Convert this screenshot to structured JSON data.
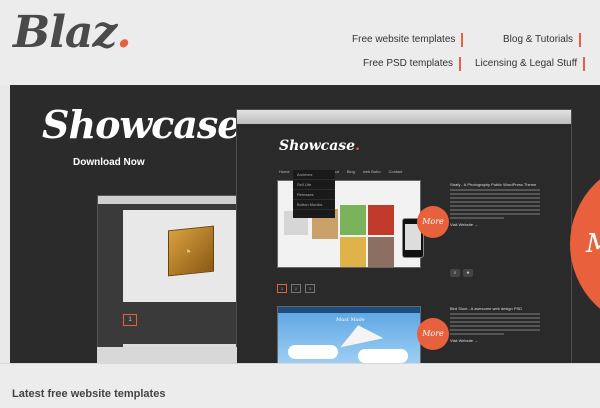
{
  "header": {
    "logo": "Blaz",
    "logo_dot": ".",
    "nav": {
      "free_website_templates": "Free website templates",
      "blog_tutorials": "Blog & Tutorials",
      "free_psd_templates": "Free PSD templates",
      "licensing_legal": "Licensing & Legal Stuff"
    }
  },
  "showcase": {
    "title": "Showcase",
    "title_dot": ".",
    "download_label": "Download Now",
    "inner": {
      "title": "Showcase",
      "title_dot": ".",
      "nav": [
        "Home",
        "Photography",
        "About",
        "Blog",
        "web Bobo",
        "Contact"
      ],
      "dropdown": [
        "Archives",
        "Sell Life",
        "Releases",
        "Button Monkis"
      ],
      "item1": {
        "heading": "Strafy - A Photography Public WordPress Theme",
        "more": "More",
        "visit": "Visit Website →"
      },
      "item2": {
        "heading": "Bird Sloot - A awesome web design PSD",
        "more": "More",
        "visit": "Visit Website →"
      },
      "pages": [
        "1",
        "2",
        "3"
      ],
      "shot2_logo": "Must Made"
    },
    "mini_page": "1",
    "big_more": "More"
  },
  "latest": {
    "title": "Latest free website templates"
  }
}
